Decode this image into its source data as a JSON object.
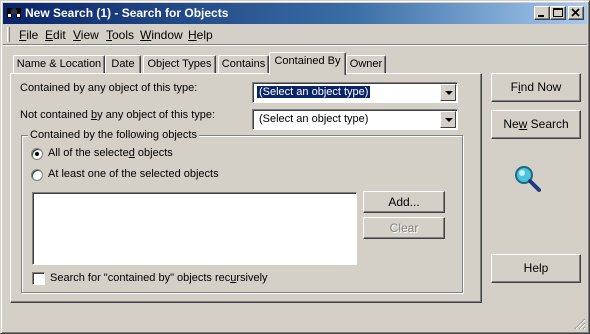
{
  "window": {
    "title": "New Search (1) - Search for Objects"
  },
  "menu": [
    {
      "pre": "",
      "u": "F",
      "post": "ile"
    },
    {
      "pre": "",
      "u": "E",
      "post": "dit"
    },
    {
      "pre": "",
      "u": "V",
      "post": "iew"
    },
    {
      "pre": "",
      "u": "T",
      "post": "ools"
    },
    {
      "pre": "",
      "u": "W",
      "post": "indow"
    },
    {
      "pre": "",
      "u": "H",
      "post": "elp"
    }
  ],
  "tabs": [
    "Name & Location",
    "Date",
    "Object Types",
    "Contains",
    "Contained By",
    "Owner"
  ],
  "active_tab": "Contained By",
  "panel": {
    "contained_by_label": "Contained by any object of this type:",
    "contained_by_value": "(Select an object type)",
    "not_contained_label_pre": "Not contained ",
    "not_contained_label_u": "b",
    "not_contained_label_post": "y any object of this type:",
    "not_contained_value": "(Select an object type)",
    "group_title": "Contained by the following objects",
    "radio_all_pre": "All of the selecte",
    "radio_all_u": "d",
    "radio_all_post": " objects",
    "radio_all_checked": true,
    "radio_one": "At least one of the selected objects",
    "add_button": "Add...",
    "clear_button": "Clear",
    "recursive_pre": "Search for \"contained by\" objects rec",
    "recursive_u": "u",
    "recursive_post": "rsively",
    "recursive_checked": false
  },
  "side_buttons": {
    "find_now_pre": "F",
    "find_now_u": "i",
    "find_now_post": "nd Now",
    "new_search_pre": "Ne",
    "new_search_u": "w",
    "new_search_post": " Search",
    "help": "Help"
  },
  "icons": {
    "app_icon": "binoculars-icon",
    "search_graphic": "magnifier-icon"
  }
}
